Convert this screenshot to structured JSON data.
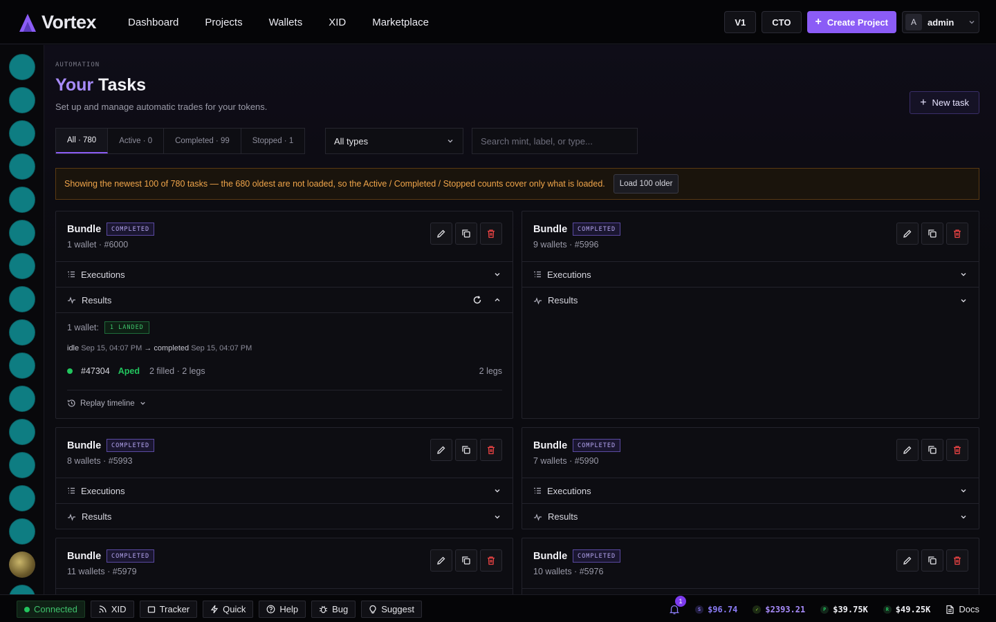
{
  "app": {
    "name": "Vortex"
  },
  "nav": [
    "Dashboard",
    "Projects",
    "Wallets",
    "XID",
    "Marketplace"
  ],
  "top_actions": {
    "v1": "V1",
    "cto": "CTO",
    "create": "Create Project",
    "avatar_initial": "A",
    "user": "admin"
  },
  "page": {
    "crumb": "AUTOMATION",
    "title_accent": "Your",
    "title_rest": "Tasks",
    "subtitle": "Set up and manage automatic trades for your tokens.",
    "new_task": "New task"
  },
  "tabs": [
    "All · 780",
    "Active · 0",
    "Completed · 99",
    "Stopped · 1"
  ],
  "filter": {
    "type_selected": "All types",
    "search_placeholder": "Search mint, label, or type..."
  },
  "banner": {
    "text": "Showing the newest 100 of 780 tasks — the 680 oldest are not loaded, so the Active / Completed / Stopped counts cover only what is loaded.",
    "load": "Load 100 older"
  },
  "cards": [
    {
      "title": "Bundle",
      "status": "COMPLETED",
      "sub": "1 wallet · #6000"
    },
    {
      "title": "Bundle",
      "status": "COMPLETED",
      "sub": "9 wallets · #5996"
    },
    {
      "title": "Bundle",
      "status": "COMPLETED",
      "sub": "8 wallets · #5993"
    },
    {
      "title": "Bundle",
      "status": "COMPLETED",
      "sub": "7 wallets · #5990"
    },
    {
      "title": "Bundle",
      "status": "COMPLETED",
      "sub": "11 wallets · #5979"
    },
    {
      "title": "Bundle",
      "status": "COMPLETED",
      "sub": "10 wallets · #5976"
    }
  ],
  "sections": {
    "executions": "Executions",
    "results": "Results"
  },
  "result": {
    "wallets": "1 wallet:",
    "landed": "1 LANDED",
    "from_state": "idle",
    "from_time": "Sep 15, 04:07 PM",
    "arrow": "→",
    "to_state": "completed",
    "to_time": "Sep 15, 04:07 PM",
    "id": "#47304",
    "state": "Aped",
    "meta": "2 filled · 2 legs",
    "legs": "2 legs",
    "replay": "Replay timeline"
  },
  "statusbar": {
    "connected": "Connected",
    "pills": [
      "XID",
      "Tracker",
      "Quick",
      "Help",
      "Bug",
      "Suggest"
    ],
    "notif_count": "1",
    "prices": [
      {
        "coin": "S",
        "value": "$96.74",
        "color": "#8b7cf6"
      },
      {
        "coin": "✓",
        "value": "$2393.21",
        "color": "#a78bfa"
      },
      {
        "coin": "P",
        "value": "$39.75K",
        "color": "#f0f0f5"
      },
      {
        "coin": "R",
        "value": "$49.25K",
        "color": "#f0f0f5"
      }
    ],
    "docs": "Docs"
  }
}
